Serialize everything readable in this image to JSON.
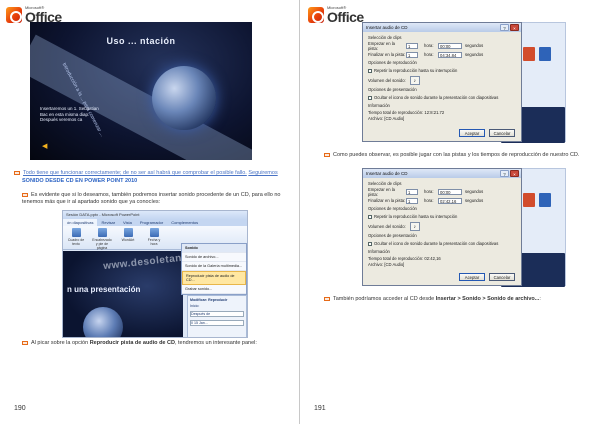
{
  "brand": {
    "small": "Microsoft®",
    "name": "Office"
  },
  "left": {
    "slide": {
      "title": "Uso ... ntación",
      "caption": "Insertaremos un 1. Sebastian Bac en esta misma diap. Después veremos ca",
      "vertical_text": "Introducción a la ... para comenzar ..."
    },
    "intro_line_1": "Todo tiene que funcionar correctamente; de no ser así habrá que comprobar el posible fallo.",
    "intro_link": "Seguiremos",
    "heading": "SONIDO DESDE CD EN POWER POINT 2010",
    "para_1": "Es evidente que si lo deseamos, también podremos insertar sonido procedente de un CD, para ello no tenemos más que ir al apartado sonido que ya conocíes:",
    "ppt": {
      "titlebar": "Sesión DATA.pptx - Microsoft PowerPoint",
      "tabs": [
        "ón diapositivas",
        "Revisar",
        "Vista",
        "Programador",
        "Complementos"
      ],
      "ribbon": [
        "Cuadro de texto",
        "Encabezado y pie de página",
        "WordArt",
        "Fecha y hora"
      ],
      "watermark": "www.desoletanda.com",
      "slide_title": "n una presentación",
      "menu": [
        "Sonido de archivo...",
        "Sonido de la Galería multimedia...",
        "Reproducir pista de audio de CD...",
        "Grabar sonido..."
      ],
      "menu_header": "Sonido",
      "panel_title": "Modificar: Reproducir",
      "panel_label": "Inicio:",
      "panel_value": "Después de",
      "panel_item": "0  15 Jan..."
    },
    "para_2_pre": "Al picar sobre la opción",
    "para_2_bold": "Reproducir pista de audio de CD",
    "para_2_post": ", tendremos un interesante panel:",
    "page_number": "190"
  },
  "right": {
    "dialog_top": {
      "title": "Insertar audio de CD",
      "help": "?",
      "close": "×",
      "section_clips": "Selección de clips",
      "start_track_label": "Empezar en la pista:",
      "start_track": "1",
      "start_time_label": "hora:",
      "start_time": "00:00",
      "start_unit": "segundos",
      "end_track_label": "Finalizar en la pista:",
      "end_track": "1",
      "end_time_label": "hora:",
      "end_time": "04:34.84",
      "end_unit": "segundos",
      "section_play": "Opciones de reproducción",
      "loop_label": "Repetir la reproducción hasta su interrupción",
      "volume_label": "Volumen del sonido:",
      "section_display": "Opciones de presentación",
      "hide_label": "Ocultar el icono de sonido durante la presentación con diapositivas",
      "section_info": "Información",
      "total_label": "Tiempo total de reproducción:",
      "total_value": "12:8:21.72",
      "file_label": "Archivo:",
      "file_value": "[CD Audio]",
      "ok": "Aceptar",
      "cancel": "Cancelar"
    },
    "caption_1": "Como puedes observar, es posible jugar con las pistas y los tiempos de reproducción de nuestro CD.",
    "dialog_bot": {
      "title": "Insertar audio de CD",
      "help": "?",
      "close": "×",
      "section_clips": "Selección de clips",
      "start_track_label": "Empezar en la pista:",
      "start_track": "1",
      "start_time_label": "hora:",
      "start_time": "00:00",
      "start_unit": "segundos",
      "end_track_label": "Finalizar en la pista:",
      "end_track": "1",
      "end_time_label": "hora:",
      "end_time": "02:42,16",
      "end_unit": "segundos",
      "section_play": "Opciones de reproducción",
      "loop_label": "Repetir la reproducción hasta su interrupción",
      "volume_label": "Volumen del sonido:",
      "section_display": "Opciones de presentación",
      "hide_label": "Ocultar el icono de sonido durante la presentación con diapositivas",
      "section_info": "Información",
      "total_label": "Tiempo total de reproducción:",
      "total_value": "02:42,16",
      "file_label": "Archivo:",
      "file_value": "[CD Audio]",
      "ok": "Aceptar",
      "cancel": "Cancelar"
    },
    "caption_2_pre": "También podríamos acceder al CD desde",
    "caption_2_bold": "Insertar > Sonido > Sonido de archivo...",
    "caption_2_post": ":",
    "page_number": "191"
  },
  "colors": {
    "heading": "#2c63c4",
    "bullet": "#e66a18",
    "logo": "#e8420b"
  }
}
